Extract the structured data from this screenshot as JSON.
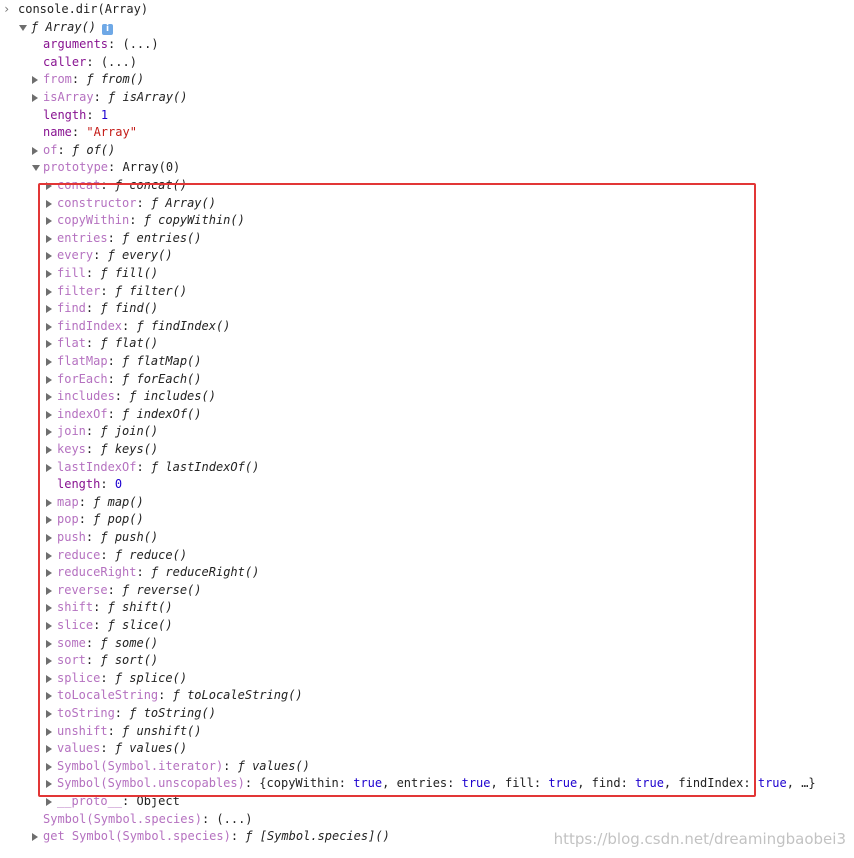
{
  "console": {
    "prompt": "console.dir(Array)",
    "root_label_f": "ƒ",
    "root_label_name": "Array()",
    "info_icon": "i"
  },
  "top_props": [
    {
      "key": "arguments",
      "value": "(...)",
      "kind": "plain",
      "expandable": false,
      "dim": false
    },
    {
      "key": "caller",
      "value": "(...)",
      "kind": "plain",
      "expandable": false,
      "dim": false
    },
    {
      "key": "from",
      "value": "from()",
      "kind": "fn",
      "expandable": true,
      "dim": true
    },
    {
      "key": "isArray",
      "value": "isArray()",
      "kind": "fn",
      "expandable": true,
      "dim": true
    },
    {
      "key": "length",
      "value": "1",
      "kind": "num",
      "expandable": false,
      "dim": false
    },
    {
      "key": "name",
      "value": "\"Array\"",
      "kind": "str",
      "expandable": false,
      "dim": false
    },
    {
      "key": "of",
      "value": "of()",
      "kind": "fn",
      "expandable": true,
      "dim": true
    },
    {
      "key": "prototype",
      "value": "Array(0)",
      "kind": "plain",
      "expandable": true,
      "expanded": true,
      "dim": true
    }
  ],
  "prototype_props": [
    {
      "key": "concat",
      "value": "concat()",
      "kind": "fn"
    },
    {
      "key": "constructor",
      "value": "Array()",
      "kind": "fn"
    },
    {
      "key": "copyWithin",
      "value": "copyWithin()",
      "kind": "fn"
    },
    {
      "key": "entries",
      "value": "entries()",
      "kind": "fn"
    },
    {
      "key": "every",
      "value": "every()",
      "kind": "fn"
    },
    {
      "key": "fill",
      "value": "fill()",
      "kind": "fn"
    },
    {
      "key": "filter",
      "value": "filter()",
      "kind": "fn"
    },
    {
      "key": "find",
      "value": "find()",
      "kind": "fn"
    },
    {
      "key": "findIndex",
      "value": "findIndex()",
      "kind": "fn"
    },
    {
      "key": "flat",
      "value": "flat()",
      "kind": "fn"
    },
    {
      "key": "flatMap",
      "value": "flatMap()",
      "kind": "fn"
    },
    {
      "key": "forEach",
      "value": "forEach()",
      "kind": "fn"
    },
    {
      "key": "includes",
      "value": "includes()",
      "kind": "fn"
    },
    {
      "key": "indexOf",
      "value": "indexOf()",
      "kind": "fn"
    },
    {
      "key": "join",
      "value": "join()",
      "kind": "fn"
    },
    {
      "key": "keys",
      "value": "keys()",
      "kind": "fn"
    },
    {
      "key": "lastIndexOf",
      "value": "lastIndexOf()",
      "kind": "fn"
    },
    {
      "key": "length",
      "value": "0",
      "kind": "num",
      "expandable": false
    },
    {
      "key": "map",
      "value": "map()",
      "kind": "fn"
    },
    {
      "key": "pop",
      "value": "pop()",
      "kind": "fn"
    },
    {
      "key": "push",
      "value": "push()",
      "kind": "fn"
    },
    {
      "key": "reduce",
      "value": "reduce()",
      "kind": "fn"
    },
    {
      "key": "reduceRight",
      "value": "reduceRight()",
      "kind": "fn"
    },
    {
      "key": "reverse",
      "value": "reverse()",
      "kind": "fn"
    },
    {
      "key": "shift",
      "value": "shift()",
      "kind": "fn"
    },
    {
      "key": "slice",
      "value": "slice()",
      "kind": "fn"
    },
    {
      "key": "some",
      "value": "some()",
      "kind": "fn"
    },
    {
      "key": "sort",
      "value": "sort()",
      "kind": "fn"
    },
    {
      "key": "splice",
      "value": "splice()",
      "kind": "fn"
    },
    {
      "key": "toLocaleString",
      "value": "toLocaleString()",
      "kind": "fn"
    },
    {
      "key": "toString",
      "value": "toString()",
      "kind": "fn"
    },
    {
      "key": "unshift",
      "value": "unshift()",
      "kind": "fn"
    },
    {
      "key": "values",
      "value": "values()",
      "kind": "fn"
    },
    {
      "key": "Symbol(Symbol.iterator)",
      "value": "values()",
      "kind": "fn"
    },
    {
      "key": "Symbol(Symbol.unscopables)",
      "value": "",
      "kind": "object",
      "object_parts": [
        {
          "t": "{copyWithin: ",
          "c": "plain"
        },
        {
          "t": "true",
          "c": "kw"
        },
        {
          "t": ", entries: ",
          "c": "plain"
        },
        {
          "t": "true",
          "c": "kw"
        },
        {
          "t": ", fill: ",
          "c": "plain"
        },
        {
          "t": "true",
          "c": "kw"
        },
        {
          "t": ", find: ",
          "c": "plain"
        },
        {
          "t": "true",
          "c": "kw"
        },
        {
          "t": ", findIndex: ",
          "c": "plain"
        },
        {
          "t": "true",
          "c": "kw"
        },
        {
          "t": ", …}",
          "c": "plain"
        }
      ]
    },
    {
      "key": "__proto__",
      "value": "Object",
      "kind": "plain"
    }
  ],
  "after_props": [
    {
      "key": "Symbol(Symbol.species)",
      "value": "(...)",
      "kind": "plain",
      "expandable": false,
      "dim": true
    },
    {
      "key": "get Symbol(Symbol.species)",
      "value": "[Symbol.species]()",
      "kind": "fn",
      "expandable": true,
      "dim": true
    }
  ],
  "f_glyph": "ƒ",
  "watermark": "https://blog.csdn.net/dreamingbaobei3",
  "colors": {
    "highlight": "#e23636",
    "key": "#881391",
    "number": "#1c00cf",
    "string": "#c41a16"
  }
}
